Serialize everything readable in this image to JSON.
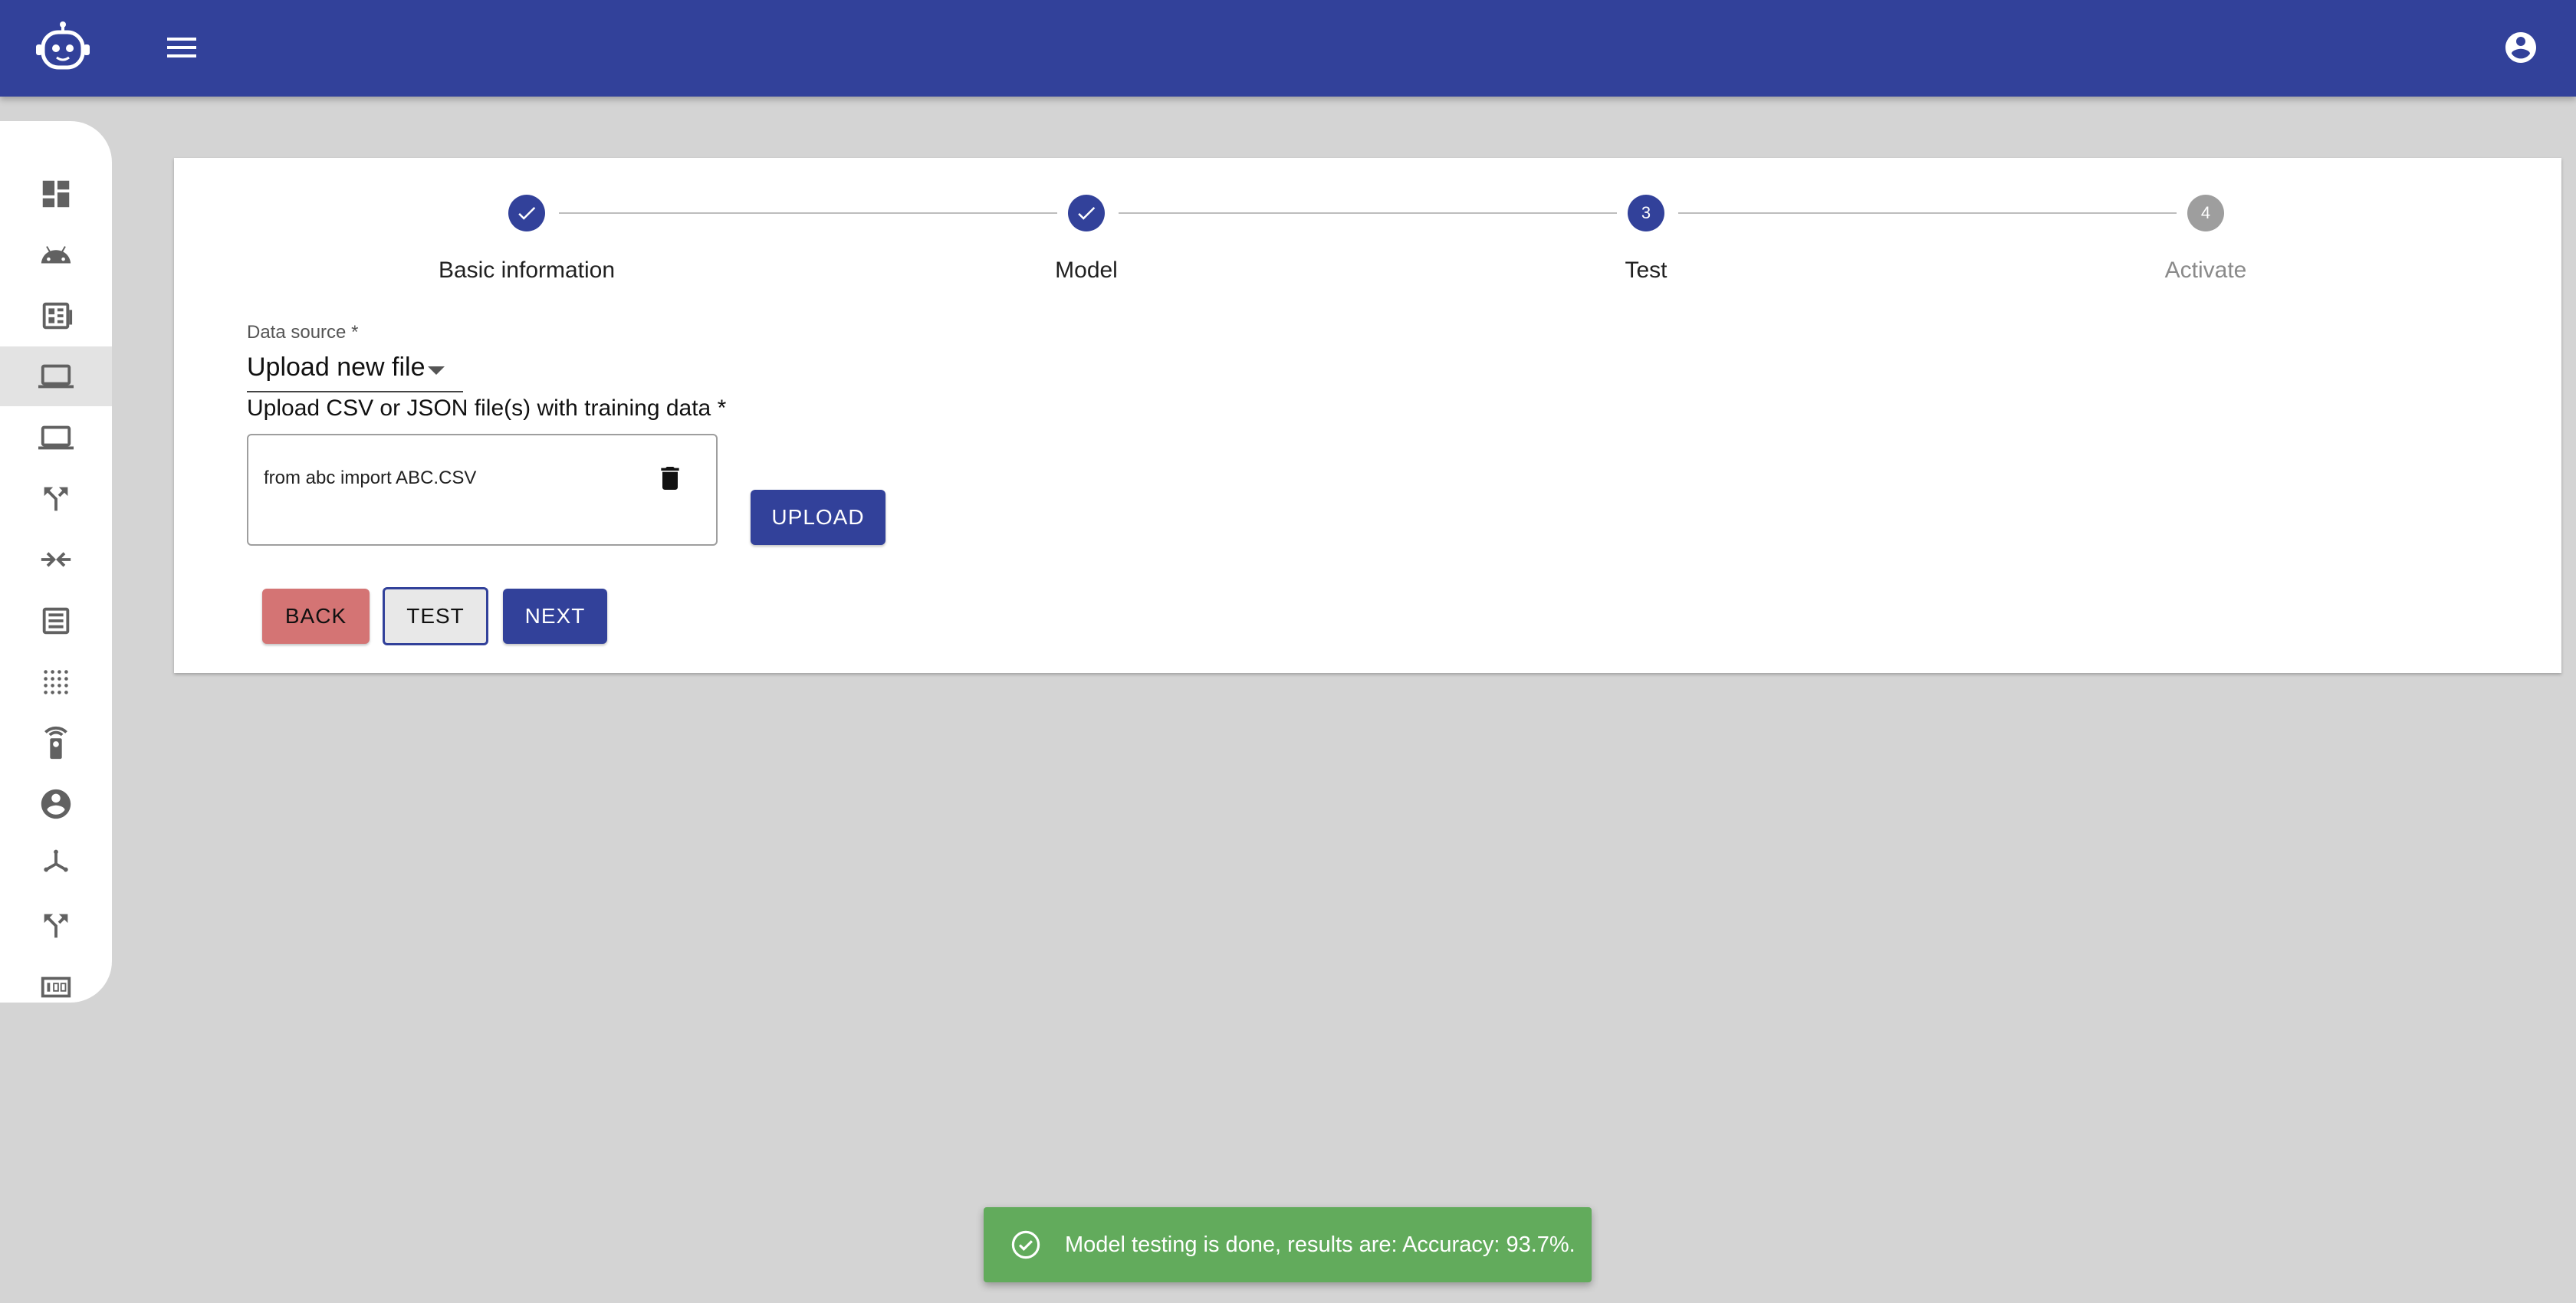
{
  "colors": {
    "primary": "#32419a",
    "background": "#d4d4d4",
    "back_button": "#d47474",
    "success": "#62ab5c",
    "inactive_step": "#9e9e9e"
  },
  "appbar": {
    "logo_icon": "robot-icon",
    "menu_icon": "menu-icon",
    "account_icon": "account-circle-icon"
  },
  "sidebar": {
    "items": [
      {
        "icon": "dashboard-icon"
      },
      {
        "icon": "android-icon"
      },
      {
        "icon": "newspaper-icon"
      },
      {
        "icon": "laptop-icon",
        "active": true
      },
      {
        "icon": "computer-icon"
      },
      {
        "icon": "call-split-icon"
      },
      {
        "icon": "arrow-merge-icon"
      },
      {
        "icon": "list-document-icon"
      },
      {
        "icon": "grain-dots-icon"
      },
      {
        "icon": "remote-signal-icon"
      },
      {
        "icon": "account-circle-icon"
      },
      {
        "icon": "hub-icon"
      },
      {
        "icon": "call-split-icon"
      },
      {
        "icon": "counter-icon"
      }
    ]
  },
  "stepper": {
    "steps": [
      {
        "label": "Basic information",
        "state": "done"
      },
      {
        "label": "Model",
        "state": "done"
      },
      {
        "label": "Test",
        "number": "3",
        "state": "active"
      },
      {
        "label": "Activate",
        "number": "4",
        "state": "inactive"
      }
    ]
  },
  "form": {
    "data_source_label": "Data source *",
    "data_source_value": "Upload new file",
    "upload_label": "Upload CSV or JSON file(s) with training data *",
    "file_name": "from abc import ABC.CSV",
    "upload_button": "UPLOAD"
  },
  "actions": {
    "back": "BACK",
    "test": "TEST",
    "next": "NEXT"
  },
  "snackbar": {
    "message": "Model testing is done, results are: Accuracy: 93.7%."
  }
}
